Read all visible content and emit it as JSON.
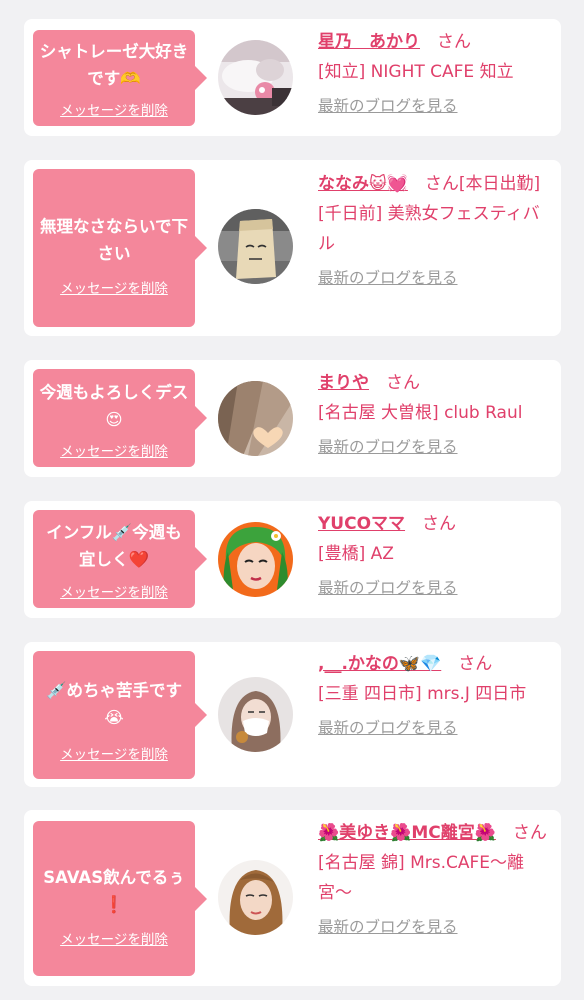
{
  "colors": {
    "accent_pink": "#f4879b",
    "name_pink": "#e0406b",
    "muted_gray": "#9a9a9a",
    "background": "#f1f1f3"
  },
  "delete_label": "メッセージを削除",
  "blog_label": "最新のブログを見る",
  "suffix": "さん",
  "messages": [
    {
      "text": "シャトレーゼ大好きです🫶",
      "name": "星乃　あかり",
      "status": "",
      "shop": "[知立] NIGHT CAFE 知立",
      "avatar": "cake-photo"
    },
    {
      "text": "無理なさならいで下さい",
      "name": "ななみ😺💓",
      "status": "[本日出勤]",
      "shop": "[千日前] 美熟女フェスティバル",
      "avatar": "paper-bag-face"
    },
    {
      "text": "今週もよろしくデス😍",
      "name": "まりや",
      "status": "",
      "shop": "[名古屋 大曽根] club Raul",
      "avatar": "hair-heart"
    },
    {
      "text": "インフル💉今週も宜しく❤️",
      "name": "YUCOママ",
      "status": "",
      "shop": "[豊橋] AZ",
      "avatar": "green-hair-illustration"
    },
    {
      "text": "💉めちゃ苦手です😭",
      "name": ",__.かなの🦋💎",
      "status": "",
      "shop": "[三重 四日市] mrs.J 四日市",
      "avatar": "masked-selfie"
    },
    {
      "text": "SAVAS飲んでるぅ❗",
      "name": "🌺美ゆき🌺MC離宮🌺",
      "status": "",
      "shop": "[名古屋 錦] Mrs.CAFE〜離宮〜",
      "avatar": "long-hair-portrait"
    }
  ]
}
